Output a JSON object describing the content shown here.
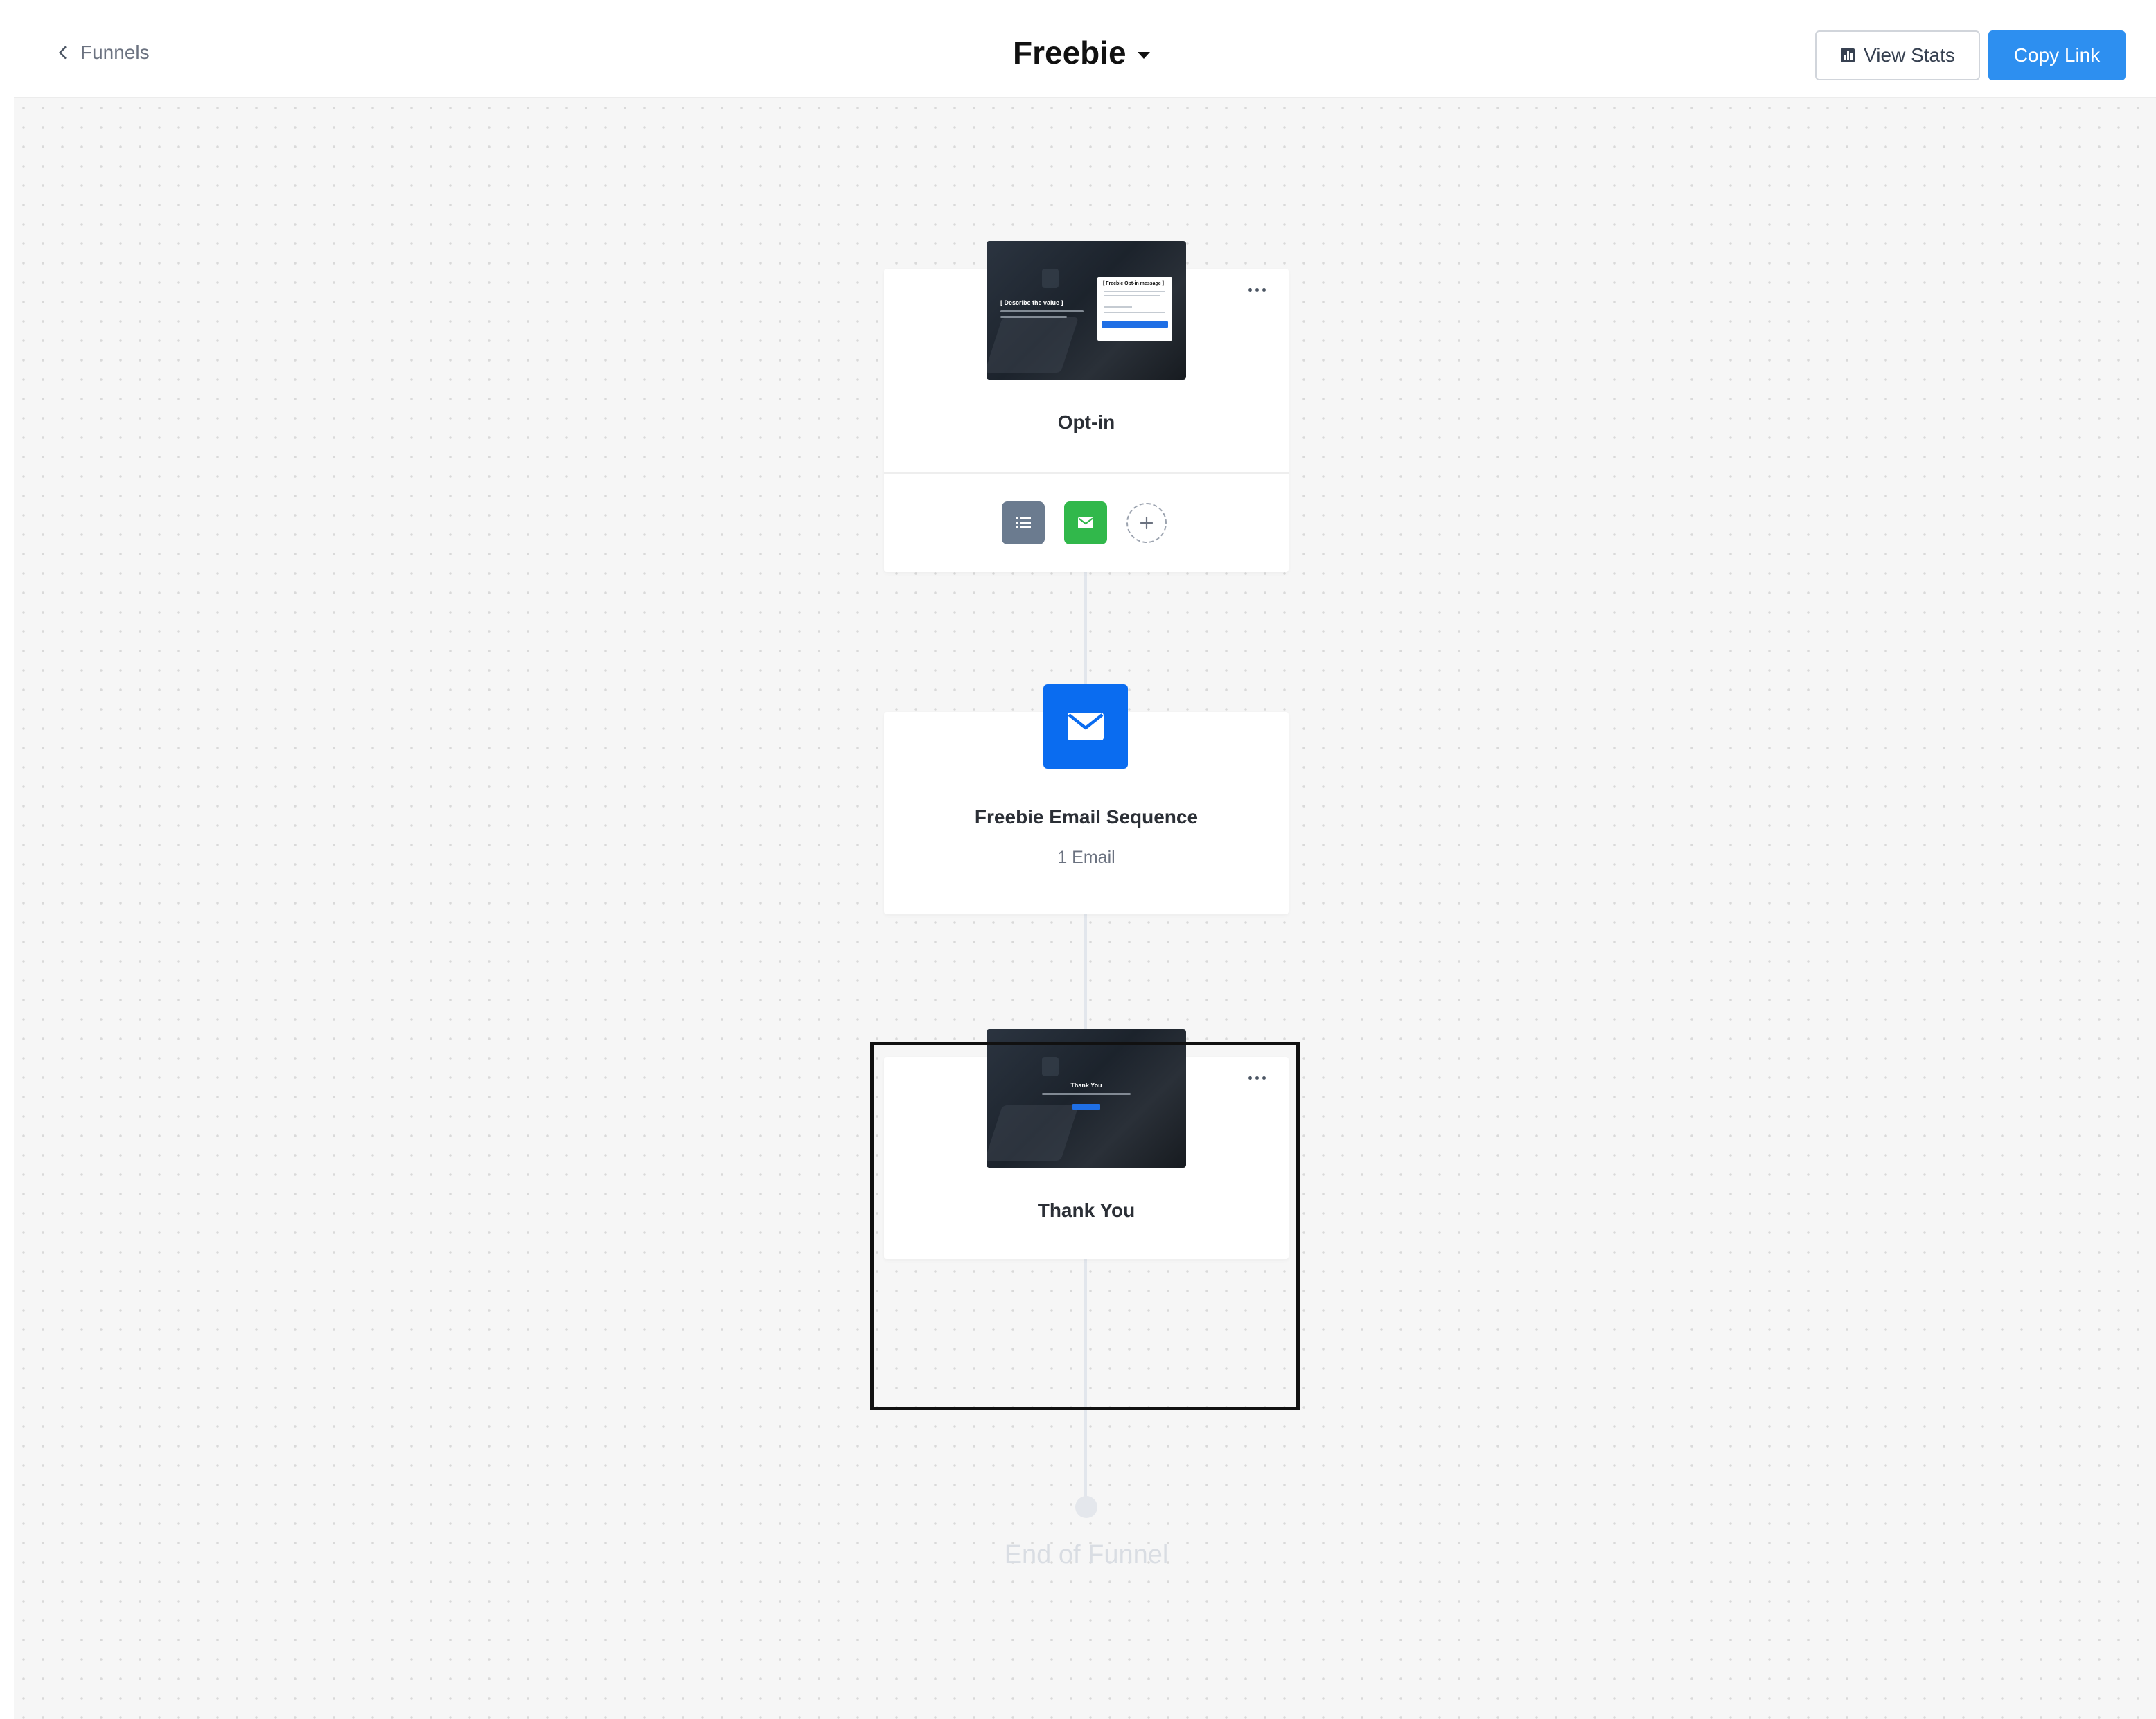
{
  "header": {
    "back_label": "Funnels",
    "funnel_title": "Freebie",
    "view_stats_label": "View Stats",
    "copy_link_label": "Copy Link"
  },
  "colors": {
    "primary_button": "#2d8ff0",
    "email_step": "#0a6cf0",
    "list_action": "#6b7b8f",
    "email_action": "#31b84b",
    "canvas_bg": "#f6f6f6"
  },
  "steps": [
    {
      "type": "page",
      "name": "Opt-in",
      "thumbnail": {
        "heading": "[ Describe the value ]",
        "panel_title": "[ Freebie Opt-in message ]"
      },
      "actions": [
        {
          "icon": "list-icon"
        },
        {
          "icon": "email-icon"
        },
        {
          "icon": "add-icon"
        }
      ],
      "menu_icon": "more-icon"
    },
    {
      "type": "email_sequence",
      "name": "Freebie Email Sequence",
      "subtitle": "1 Email",
      "icon": "envelope-icon"
    },
    {
      "type": "page",
      "name": "Thank You",
      "thumbnail": {
        "heading": "Thank You"
      },
      "menu_icon": "more-icon"
    }
  ],
  "end_label": "End of Funnel"
}
